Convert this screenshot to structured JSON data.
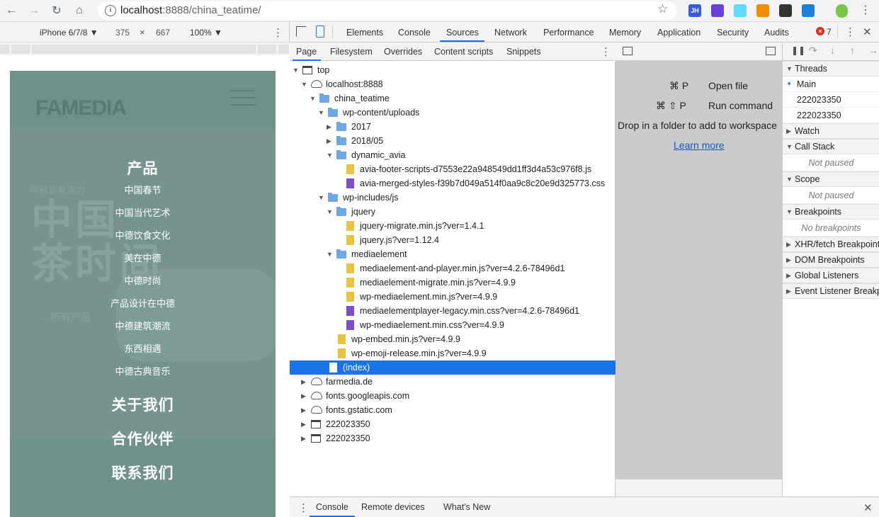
{
  "browser": {
    "url_host": "localhost",
    "url_path": ":8888/china_teatime/",
    "extensions": [
      {
        "name": "jh-extension-icon",
        "label": "JH",
        "color": "#3b5bdb"
      },
      {
        "name": "purple-extension-icon",
        "label": "",
        "color": "#6741d9"
      },
      {
        "name": "react-devtools-icon",
        "label": "",
        "color": "#61dafb"
      },
      {
        "name": "orange-extension-icon",
        "label": "",
        "color": "#f08c00"
      },
      {
        "name": "qr-code-extension-icon",
        "label": "",
        "color": "#333333"
      },
      {
        "name": "blue-globe-extension-icon",
        "label": "",
        "color": "#1c7ed6"
      }
    ]
  },
  "device_toolbar": {
    "device": "iPhone 6/7/8 ▼",
    "width": "375",
    "times": "×",
    "height": "667",
    "zoom": "100% ▼"
  },
  "mobile": {
    "logo": "FAMEDIA",
    "ghost_title": "中国\n茶时间",
    "ghost_tagline": "年轻且有活力",
    "ghost_link": "→ 所有产品",
    "menu_heading_products": "产品",
    "submenu": [
      "中国春节",
      "中国当代艺术",
      "中德饮食文化",
      "美在中德",
      "中德时尚",
      "产品设计在中德",
      "中德建筑潮流",
      "东西相遇",
      "中德古典音乐"
    ],
    "menu_about": "关于我们",
    "menu_partners": "合作伙伴",
    "menu_contact": "联系我们"
  },
  "devtools": {
    "tabs": [
      "Elements",
      "Console",
      "Sources",
      "Network",
      "Performance",
      "Memory",
      "Application",
      "Security",
      "Audits"
    ],
    "error_count": "7",
    "navigator_tabs": [
      "Page",
      "Filesystem",
      "Overrides",
      "Content scripts",
      "Snippets"
    ],
    "tree": [
      {
        "label": "top",
        "icon": "frame",
        "tri": "▼",
        "depth": 0
      },
      {
        "label": "localhost:8888",
        "icon": "cloud",
        "tri": "▼",
        "depth": 1
      },
      {
        "label": "china_teatime",
        "icon": "folder",
        "tri": "▼",
        "depth": 2
      },
      {
        "label": "wp-content/uploads",
        "icon": "folder",
        "tri": "▼",
        "depth": 3
      },
      {
        "label": "2017",
        "icon": "folder",
        "tri": "▶",
        "depth": 4
      },
      {
        "label": "2018/05",
        "icon": "folder",
        "tri": "▶",
        "depth": 4
      },
      {
        "label": "dynamic_avia",
        "icon": "folder",
        "tri": "▼",
        "depth": 4
      },
      {
        "label": "avia-footer-scripts-d7553e22a948549dd1ff3d4a53c976f8.js",
        "icon": "js",
        "tri": "",
        "depth": 5
      },
      {
        "label": "avia-merged-styles-f39b7d049a514f0aa9c8c20e9d325773.css",
        "icon": "css",
        "tri": "",
        "depth": 5
      },
      {
        "label": "wp-includes/js",
        "icon": "folder",
        "tri": "▼",
        "depth": 3
      },
      {
        "label": "jquery",
        "icon": "folder",
        "tri": "▼",
        "depth": 4
      },
      {
        "label": "jquery-migrate.min.js?ver=1.4.1",
        "icon": "js",
        "tri": "",
        "depth": 5
      },
      {
        "label": "jquery.js?ver=1.12.4",
        "icon": "js",
        "tri": "",
        "depth": 5
      },
      {
        "label": "mediaelement",
        "icon": "folder",
        "tri": "▼",
        "depth": 4
      },
      {
        "label": "mediaelement-and-player.min.js?ver=4.2.6-78496d1",
        "icon": "js",
        "tri": "",
        "depth": 5
      },
      {
        "label": "mediaelement-migrate.min.js?ver=4.9.9",
        "icon": "js",
        "tri": "",
        "depth": 5
      },
      {
        "label": "wp-mediaelement.min.js?ver=4.9.9",
        "icon": "js",
        "tri": "",
        "depth": 5
      },
      {
        "label": "mediaelementplayer-legacy.min.css?ver=4.2.6-78496d1",
        "icon": "css",
        "tri": "",
        "depth": 5
      },
      {
        "label": "wp-mediaelement.min.css?ver=4.9.9",
        "icon": "css",
        "tri": "",
        "depth": 5
      },
      {
        "label": "wp-embed.min.js?ver=4.9.9",
        "icon": "js",
        "tri": "",
        "depth": 4
      },
      {
        "label": "wp-emoji-release.min.js?ver=4.9.9",
        "icon": "js",
        "tri": "",
        "depth": 4
      },
      {
        "label": "(index)",
        "icon": "doc",
        "tri": "",
        "depth": 3,
        "selected": true
      },
      {
        "label": "farmedia.de",
        "icon": "cloud",
        "tri": "▶",
        "depth": 1
      },
      {
        "label": "fonts.googleapis.com",
        "icon": "cloud",
        "tri": "▶",
        "depth": 1
      },
      {
        "label": "fonts.gstatic.com",
        "icon": "cloud",
        "tri": "▶",
        "depth": 1
      },
      {
        "label": "222023350",
        "icon": "frame",
        "tri": "▶",
        "depth": 1
      },
      {
        "label": "222023350",
        "icon": "frame",
        "tri": "▶",
        "depth": 1
      }
    ],
    "editor": {
      "shortcut_open_keys": "⌘ P",
      "shortcut_open_label": "Open file",
      "shortcut_run_keys": "⌘ ⇧ P",
      "shortcut_run_label": "Run command",
      "drop_hint": "Drop in a folder to add to workspace",
      "learn_more": "Learn more"
    },
    "debugger": {
      "threads_label": "Threads",
      "threads": [
        "Main",
        "222023350",
        "222023350"
      ],
      "watch_label": "Watch",
      "call_stack_label": "Call Stack",
      "call_stack_note": "Not paused",
      "scope_label": "Scope",
      "scope_note": "Not paused",
      "breakpoints_label": "Breakpoints",
      "breakpoints_note": "No breakpoints",
      "xhr_label": "XHR/fetch Breakpoints",
      "dom_label": "DOM Breakpoints",
      "global_label": "Global Listeners",
      "event_label": "Event Listener Breakpoints"
    },
    "drawer_tabs": [
      "Console",
      "Remote devices",
      "What's New"
    ]
  }
}
